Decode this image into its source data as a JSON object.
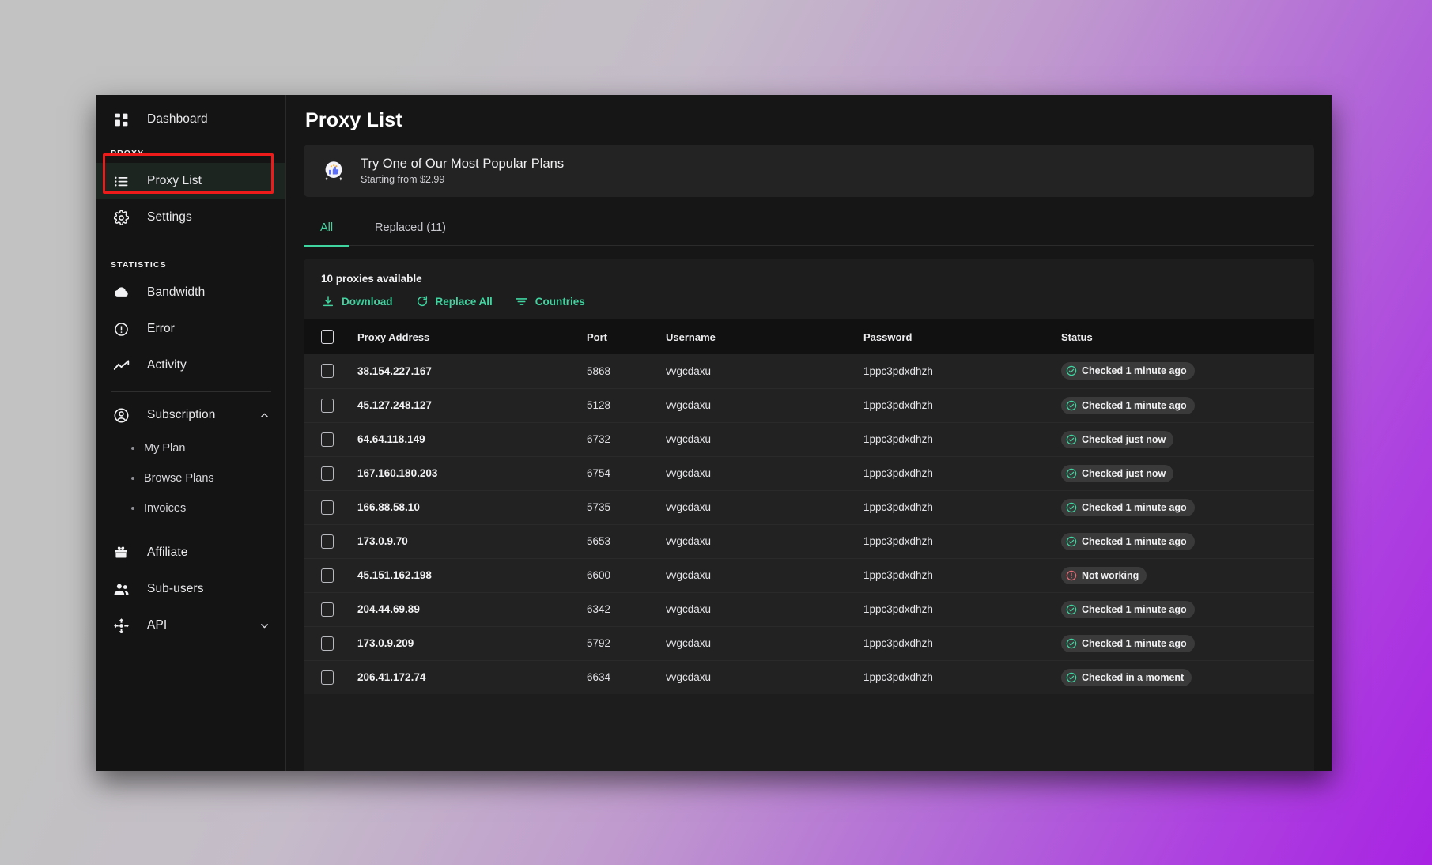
{
  "sidebar": {
    "top_items": [
      {
        "label": "Dashboard",
        "icon": "dashboard-grid-icon",
        "name": "dashboard"
      }
    ],
    "proxy_section_label": "PROXY",
    "proxy_items": [
      {
        "label": "Proxy List",
        "icon": "list-icon",
        "name": "proxy-list",
        "active": true
      },
      {
        "label": "Settings",
        "icon": "gear-icon",
        "name": "settings",
        "active": false
      }
    ],
    "statistics_section_label": "STATISTICS",
    "statistics_items": [
      {
        "label": "Bandwidth",
        "icon": "cloud-icon",
        "name": "bandwidth"
      },
      {
        "label": "Error",
        "icon": "alert-circle-icon",
        "name": "error"
      },
      {
        "label": "Activity",
        "icon": "activity-line-icon",
        "name": "activity"
      }
    ],
    "subscription": {
      "label": "Subscription",
      "icon": "user-circle-icon",
      "chevron": "chevron-up-icon",
      "expanded": true,
      "children": [
        {
          "label": "My Plan",
          "name": "my-plan"
        },
        {
          "label": "Browse Plans",
          "name": "browse-plans"
        },
        {
          "label": "Invoices",
          "name": "invoices"
        }
      ]
    },
    "bottom_items": [
      {
        "label": "Affiliate",
        "icon": "gift-icon",
        "name": "affiliate",
        "chevron": ""
      },
      {
        "label": "Sub-users",
        "icon": "users-icon",
        "name": "sub-users",
        "chevron": ""
      },
      {
        "label": "API",
        "icon": "api-nodes-icon",
        "name": "api",
        "chevron": "chevron-down-icon"
      }
    ]
  },
  "main": {
    "page_title": "Proxy List",
    "promo": {
      "icon": "thumbs-up-sparkle-icon",
      "title": "Try One of Our Most Popular Plans",
      "subtitle": "Starting from $2.99"
    },
    "tabs": [
      {
        "label": "All",
        "name": "tab-all",
        "active": true
      },
      {
        "label": "Replaced (11)",
        "name": "tab-replaced",
        "active": false
      }
    ],
    "proxy_count_text": "10 proxies available",
    "toolbar": [
      {
        "label": "Download",
        "icon": "download-icon",
        "name": "download"
      },
      {
        "label": "Replace All",
        "icon": "refresh-icon",
        "name": "replace-all"
      },
      {
        "label": "Countries",
        "icon": "filter-icon",
        "name": "countries"
      }
    ],
    "table": {
      "columns": [
        "Proxy Address",
        "Port",
        "Username",
        "Password",
        "Status"
      ],
      "rows": [
        {
          "address": "38.154.227.167",
          "port": "5868",
          "username": "vvgcdaxu",
          "password": "1ppc3pdxdhzh",
          "status": "Checked 1 minute ago",
          "status_state": "ok"
        },
        {
          "address": "45.127.248.127",
          "port": "5128",
          "username": "vvgcdaxu",
          "password": "1ppc3pdxdhzh",
          "status": "Checked 1 minute ago",
          "status_state": "ok"
        },
        {
          "address": "64.64.118.149",
          "port": "6732",
          "username": "vvgcdaxu",
          "password": "1ppc3pdxdhzh",
          "status": "Checked just now",
          "status_state": "ok"
        },
        {
          "address": "167.160.180.203",
          "port": "6754",
          "username": "vvgcdaxu",
          "password": "1ppc3pdxdhzh",
          "status": "Checked just now",
          "status_state": "ok"
        },
        {
          "address": "166.88.58.10",
          "port": "5735",
          "username": "vvgcdaxu",
          "password": "1ppc3pdxdhzh",
          "status": "Checked 1 minute ago",
          "status_state": "ok"
        },
        {
          "address": "173.0.9.70",
          "port": "5653",
          "username": "vvgcdaxu",
          "password": "1ppc3pdxdhzh",
          "status": "Checked 1 minute ago",
          "status_state": "ok"
        },
        {
          "address": "45.151.162.198",
          "port": "6600",
          "username": "vvgcdaxu",
          "password": "1ppc3pdxdhzh",
          "status": "Not working",
          "status_state": "fail"
        },
        {
          "address": "204.44.69.89",
          "port": "6342",
          "username": "vvgcdaxu",
          "password": "1ppc3pdxdhzh",
          "status": "Checked 1 minute ago",
          "status_state": "ok"
        },
        {
          "address": "173.0.9.209",
          "port": "5792",
          "username": "vvgcdaxu",
          "password": "1ppc3pdxdhzh",
          "status": "Checked 1 minute ago",
          "status_state": "ok"
        },
        {
          "address": "206.41.172.74",
          "port": "6634",
          "username": "vvgcdaxu",
          "password": "1ppc3pdxdhzh",
          "status": "Checked in a moment",
          "status_state": "ok"
        }
      ]
    }
  },
  "annotation": {
    "highlight_target": "proxy-list",
    "highlight_color": "#ee1b1b"
  },
  "colors": {
    "accent_green": "#3fd4a0",
    "fail_red": "#e56b76",
    "window_bg": "#161616",
    "sidebar_bg": "#141414",
    "row_bg": "#222222"
  }
}
